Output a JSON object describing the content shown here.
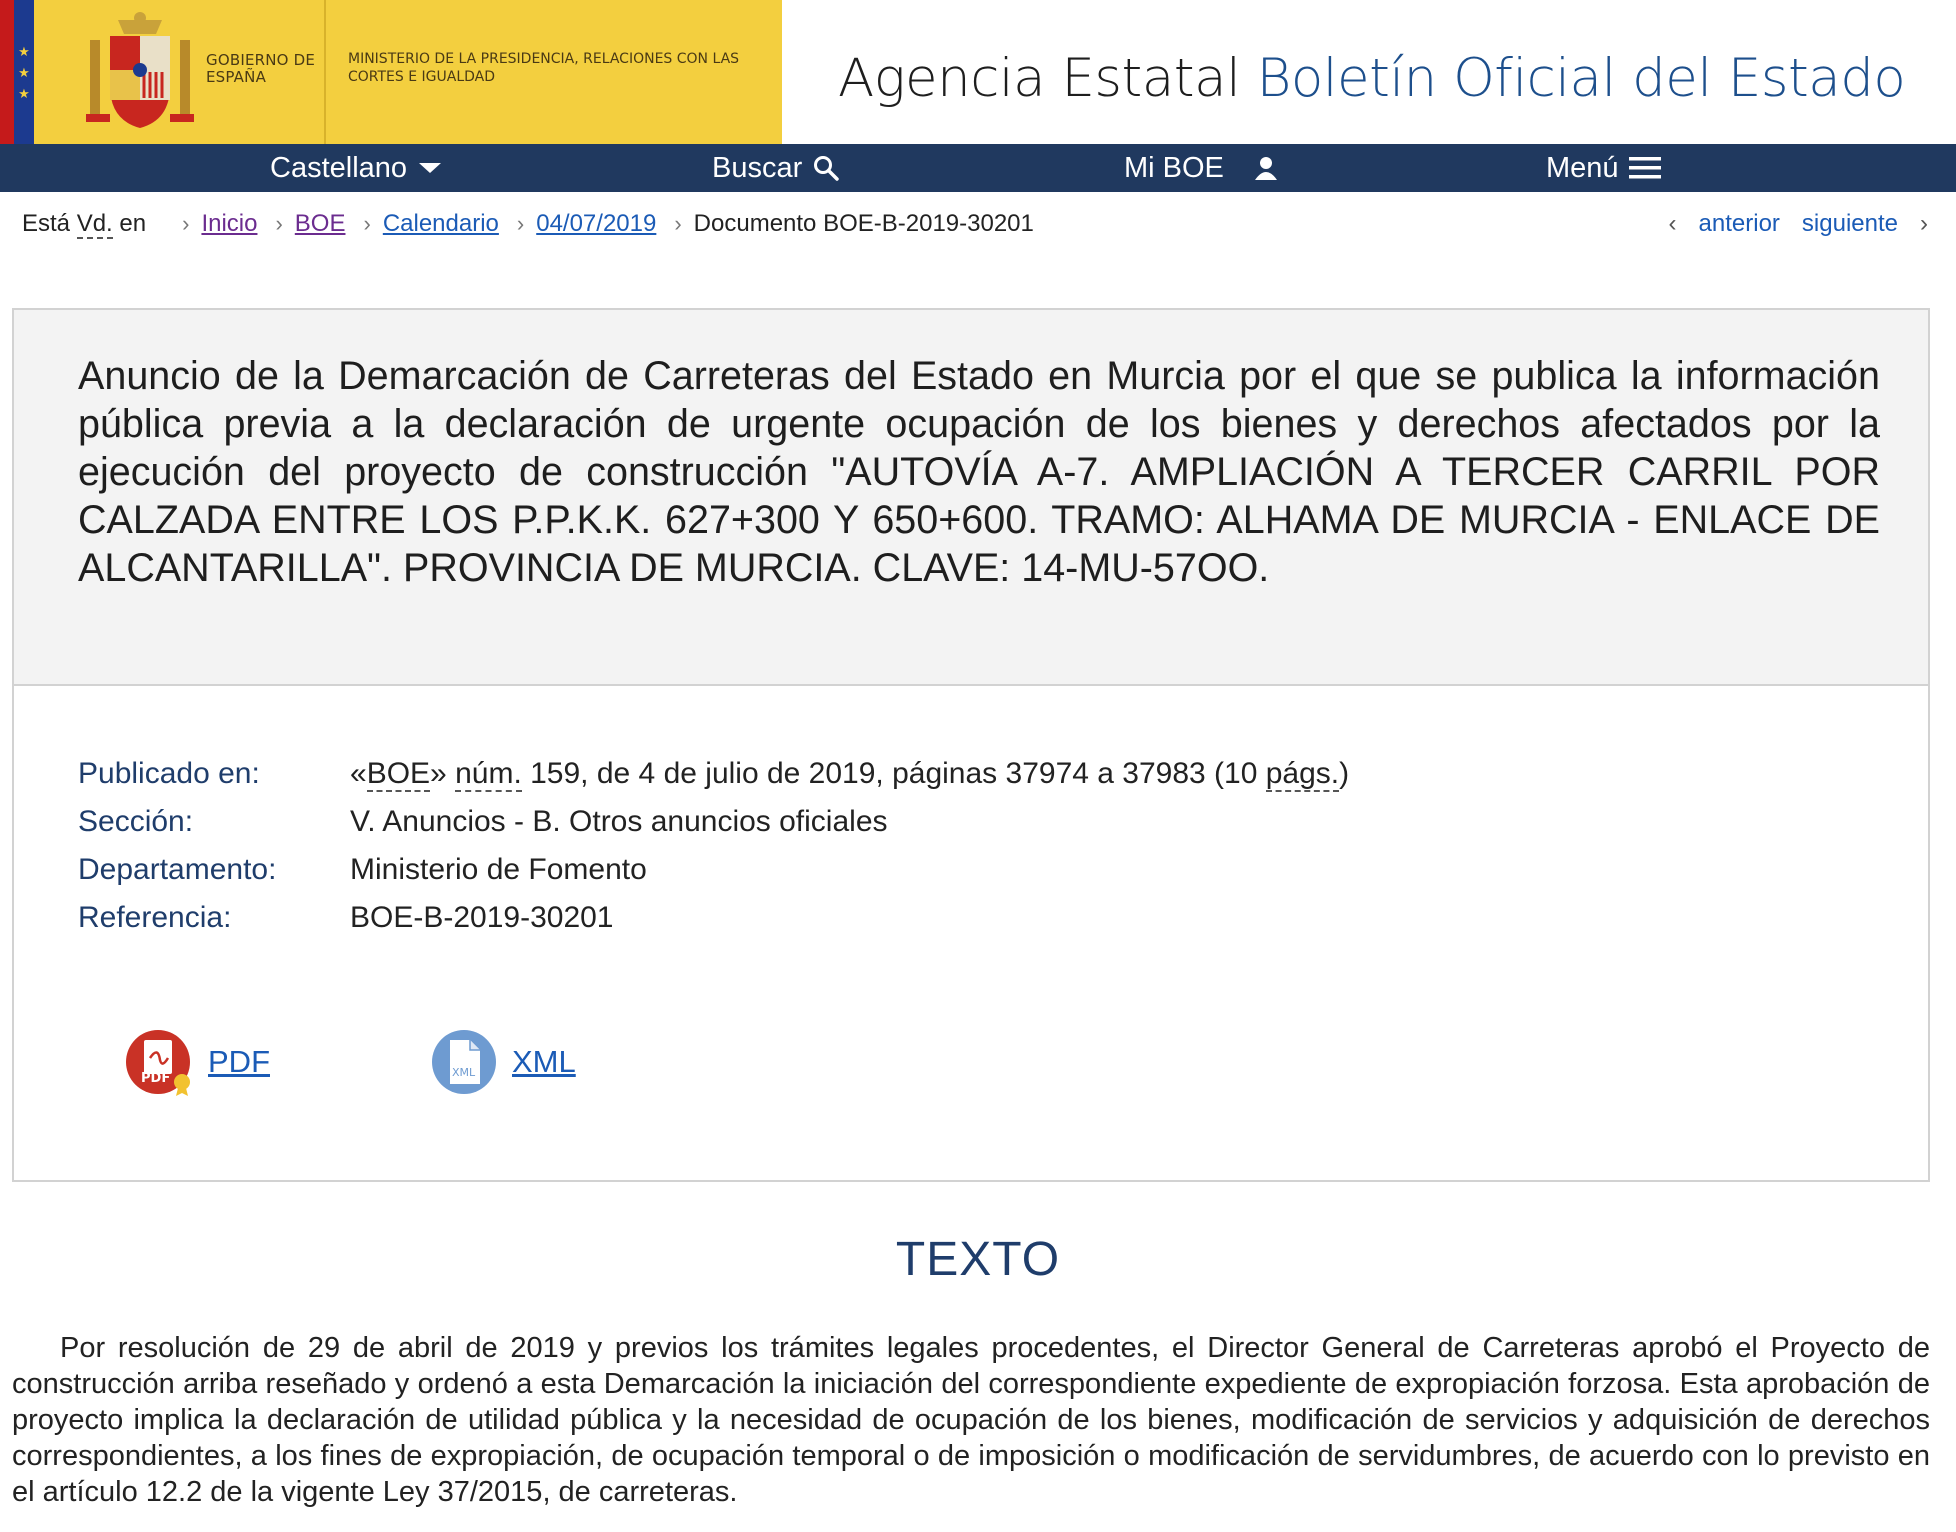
{
  "header": {
    "gov_name": "Gobierno de España",
    "ministry": "Ministerio de la Presidencia, Relaciones con las Cortes e Igualdad",
    "agency_prefix": "Agencia Estatal",
    "agency_name": "Boletín Oficial del Estado",
    "colors": {
      "yellow": "#f3cf3f",
      "navy": "#20395f",
      "brand_blue": "#1d4f8c"
    }
  },
  "nav": {
    "language": "Castellano",
    "search": "Buscar",
    "my_boe": "Mi BOE",
    "menu": "Menú"
  },
  "breadcrumb": {
    "lead_a": "Está",
    "lead_abbr": "Vd.",
    "lead_b": "en",
    "items": [
      "Inicio",
      "BOE",
      "Calendario",
      "04/07/2019"
    ],
    "current": "Documento BOE-B-2019-30201",
    "prev": "anterior",
    "next": "siguiente"
  },
  "document": {
    "title": "Anuncio de la Demarcación de Carreteras del Estado en Murcia por el que se publica la información pública previa a la declaración de urgente ocupación de los bienes y derechos afectados por la ejecución del proyecto de construcción \"AUTOVÍA A-7. AMPLIACIÓN A TERCER CARRIL POR CALZADA ENTRE LOS P.P.K.K. 627+300 Y 650+600. TRAMO: ALHAMA DE MURCIA - ENLACE DE ALCANTARILLA\". PROVINCIA DE MURCIA. CLAVE: 14-MU-57OO.",
    "meta": {
      "published_label": "Publicado en:",
      "published_q_open": "«",
      "published_boe": "BOE",
      "published_q_close": "»",
      "published_num": "núm.",
      "published_mid": "159, de 4 de julio de 2019, páginas 37974 a 37983 (10",
      "published_pags": "págs.",
      "published_end": ")",
      "section_label": "Sección:",
      "section_value": "V. Anuncios - B. Otros anuncios oficiales",
      "department_label": "Departamento:",
      "department_value": "Ministerio de Fomento",
      "reference_label": "Referencia:",
      "reference_value": "BOE-B-2019-30201"
    },
    "downloads": {
      "pdf": "PDF",
      "xml": "XML",
      "pdf_icon_text": "PDF",
      "xml_icon_text": "XML"
    }
  },
  "texto": {
    "heading": "TEXTO",
    "paragraph": "Por resolución de 29 de abril de 2019 y previos los trámites legales procedentes, el Director General de Carreteras aprobó el Proyecto de construcción arriba reseñado y ordenó a esta Demarcación la iniciación del correspondiente expediente de expropiación forzosa. Esta aprobación de proyecto implica la declaración de utilidad pública y la necesidad de ocupación de los bienes, modificación de servicios y adquisición de derechos correspondientes, a los fines de expropiación, de ocupación temporal o de imposición o modificación de servidumbres, de acuerdo con lo previsto en el artículo 12.2 de la vigente Ley 37/2015, de carreteras."
  }
}
